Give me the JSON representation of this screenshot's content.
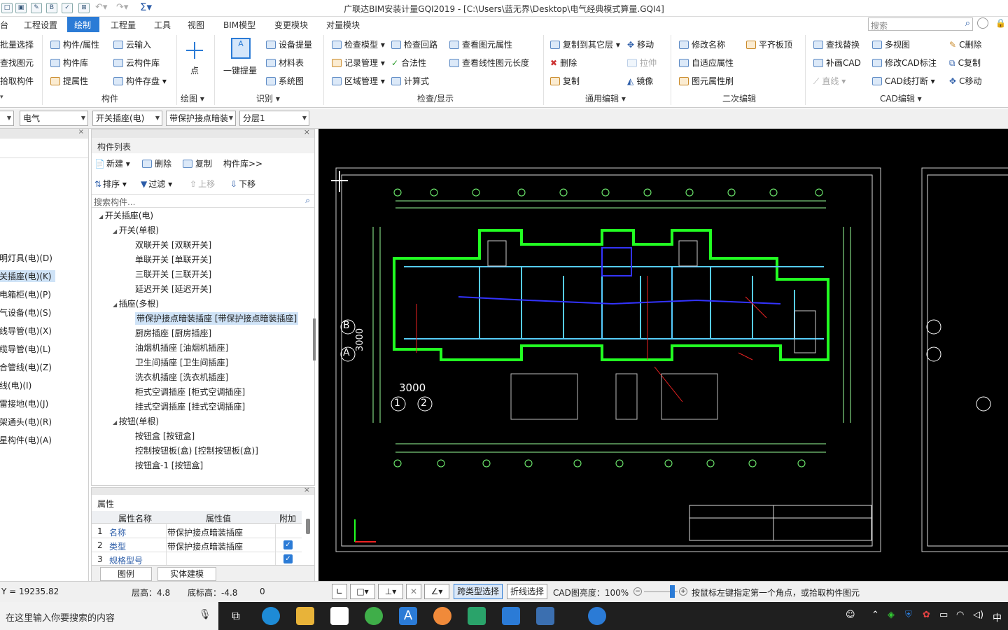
{
  "window": {
    "title": "广联达BIM安装计量GQI2019 - [C:\\Users\\蓝无界\\Desktop\\电气经典模式算量.GQI4]"
  },
  "titlebar": {
    "search_placeholder": "搜索"
  },
  "menu": [
    "台",
    "工程设置",
    "绘制",
    "工程量",
    "工具",
    "视图",
    "BIM模型",
    "变更模块",
    "对量模块"
  ],
  "ribbon": {
    "left": [
      "批量选择",
      "查找图元",
      "拾取构件"
    ],
    "component": {
      "attr": "构件/属性",
      "lib": "构件库",
      "extract": "提属性",
      "cloud_in": "云输入",
      "cloud_lib": "云构件库",
      "save": "构件存盘",
      "group": "构件"
    },
    "draw": {
      "point": "点",
      "group": "绘图"
    },
    "identify": {
      "one_click": "一键提量",
      "equip": "设备提量",
      "material": "材料表",
      "system": "系统图",
      "group": "识别"
    },
    "check": {
      "model": "检查模型",
      "loop": "检查回路",
      "attr": "查看图元属性",
      "record": "记录管理",
      "legal": "合法性",
      "linelen": "查看线性图元长度",
      "region": "区域管理",
      "formula": "计算式",
      "group": "检查/显示"
    },
    "edit": {
      "copy_floor": "复制到其它层",
      "move": "移动",
      "delete": "删除",
      "stretch": "拉伸",
      "copy": "复制",
      "mirror": "镜像",
      "group": "通用编辑"
    },
    "second": {
      "rename": "修改名称",
      "flat": "平齐板顶",
      "adapt": "自适应属性",
      "brush": "图元属性刷",
      "group": "二次编辑"
    },
    "cad": {
      "find": "查找替换",
      "multi": "多视图",
      "cdel": "C删除",
      "patch": "补画CAD",
      "modlabel": "修改CAD标注",
      "ccopy": "C复制",
      "line": "直线",
      "break": "CAD线打断",
      "cmove": "C移动",
      "group": "CAD编辑"
    }
  },
  "toolbar2": {
    "system": "电气",
    "type": "开关插座(电)",
    "item": "带保护接点暗装",
    "floor": "分层1"
  },
  "leftnav": [
    "明灯具(电)(D)",
    "关插座(电)(K)",
    "电箱柜(电)(P)",
    "气设备(电)(S)",
    "线导管(电)(X)",
    "缆导管(电)(L)",
    "合管线(电)(Z)",
    "线(电)(I)",
    "雷接地(电)(J)",
    "架通头(电)(R)",
    "星构件(电)(A)"
  ],
  "complist": {
    "title": "构件列表",
    "actions": {
      "new": "新建",
      "del": "删除",
      "copy": "复制",
      "lib": "构件库>>",
      "sort": "排序",
      "filter": "过滤",
      "up": "上移",
      "down": "下移"
    },
    "search_placeholder": "搜索构件...",
    "tree": [
      {
        "level": 0,
        "text": "开关插座(电)"
      },
      {
        "level": 1,
        "text": "开关(单根)"
      },
      {
        "level": 2,
        "text": "双联开关 [双联开关]"
      },
      {
        "level": 2,
        "text": "单联开关 [单联开关]"
      },
      {
        "level": 2,
        "text": "三联开关 [三联开关]"
      },
      {
        "level": 2,
        "text": "延迟开关 [延迟开关]"
      },
      {
        "level": 1,
        "text": "插座(多根)"
      },
      {
        "level": 2,
        "text": "带保护接点暗装插座 [带保护接点暗装插座]",
        "selected": true
      },
      {
        "level": 2,
        "text": "厨房插座 [厨房插座]"
      },
      {
        "level": 2,
        "text": "油烟机插座 [油烟机插座]"
      },
      {
        "level": 2,
        "text": "卫生间插座 [卫生间插座]"
      },
      {
        "level": 2,
        "text": "洗衣机插座 [洗衣机插座]"
      },
      {
        "level": 2,
        "text": "柜式空调插座 [柜式空调插座]"
      },
      {
        "level": 2,
        "text": "挂式空调插座 [挂式空调插座]"
      },
      {
        "level": 1,
        "text": "按钮(单根)"
      },
      {
        "level": 2,
        "text": "按钮盒 [按钮盒]"
      },
      {
        "level": 2,
        "text": "控制按钮板(盒) [控制按钮板(盒)]"
      },
      {
        "level": 2,
        "text": "按钮盒-1 [按钮盒]"
      }
    ]
  },
  "props": {
    "title": "属性",
    "headers": [
      "属性名称",
      "属性值",
      "附加"
    ],
    "rows": [
      {
        "no": "1",
        "name": "名称",
        "value": "带保护接点暗装插座",
        "check": false
      },
      {
        "no": "2",
        "name": "类型",
        "value": "带保护接点暗装插座",
        "check": true
      },
      {
        "no": "3",
        "name": "规格型号",
        "value": "",
        "check": true
      }
    ],
    "tabs": [
      "图例",
      "实体建模"
    ]
  },
  "canvas": {
    "axis_b": "B",
    "axis_a": "A",
    "axis_1": "1",
    "axis_2": "2",
    "dim_3000": "3000",
    "dim_vert": "3000"
  },
  "status": {
    "coord": "Y = 19235.82",
    "floor_h": "层高：4.8",
    "base_h": "底标高：-4.8",
    "zero": "0",
    "cross_select": "跨类型选择",
    "poly_select": "折线选择",
    "brightness": "CAD图亮度：100%",
    "hint": "按鼠标左键指定第一个角点，或拾取构件图元"
  },
  "taskbar": {
    "search": "在这里输入你要搜索的内容",
    "ime": "中"
  }
}
